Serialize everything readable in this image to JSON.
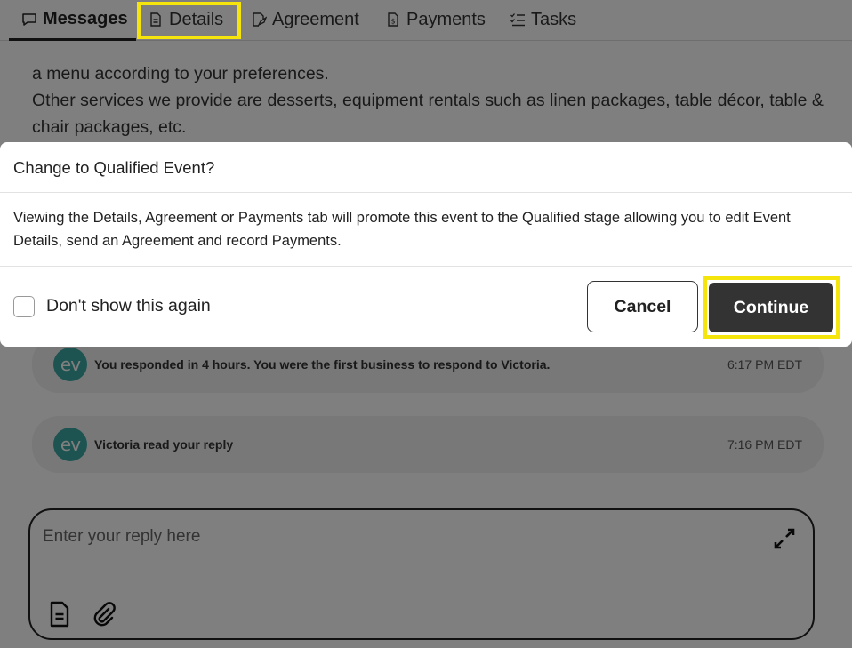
{
  "tabs": {
    "messages": "Messages",
    "details": "Details",
    "agreement": "Agreement",
    "payments": "Payments",
    "tasks": "Tasks"
  },
  "description": {
    "line1": "a menu according to your preferences.",
    "line2": "Other services we provide are desserts, equipment rentals such as linen packages, table décor, table & chair packages, etc."
  },
  "activity": [
    {
      "avatar": "ev",
      "text": "You responded in 4 hours. You were the first business to respond to Victoria.",
      "time": "6:17 PM EDT"
    },
    {
      "avatar": "ev",
      "text": "Victoria read your reply",
      "time": "7:16 PM EDT"
    }
  ],
  "reply": {
    "placeholder": "Enter your reply here"
  },
  "modal": {
    "title": "Change to Qualified Event?",
    "body": "Viewing the Details, Agreement or Payments tab will promote this event to the Qualified stage allowing you to edit Event Details, send an Agreement and record Payments.",
    "checkbox_label": "Don't show this again",
    "cancel_label": "Cancel",
    "continue_label": "Continue"
  },
  "colors": {
    "highlight": "#f5e50c",
    "primary_button": "#333333",
    "avatar": "#3aa6a2"
  },
  "icons": [
    "chat-bubble-icon",
    "document-icon",
    "signature-icon",
    "receipt-icon",
    "checklist-icon",
    "expand-icon",
    "template-icon",
    "paperclip-icon"
  ]
}
